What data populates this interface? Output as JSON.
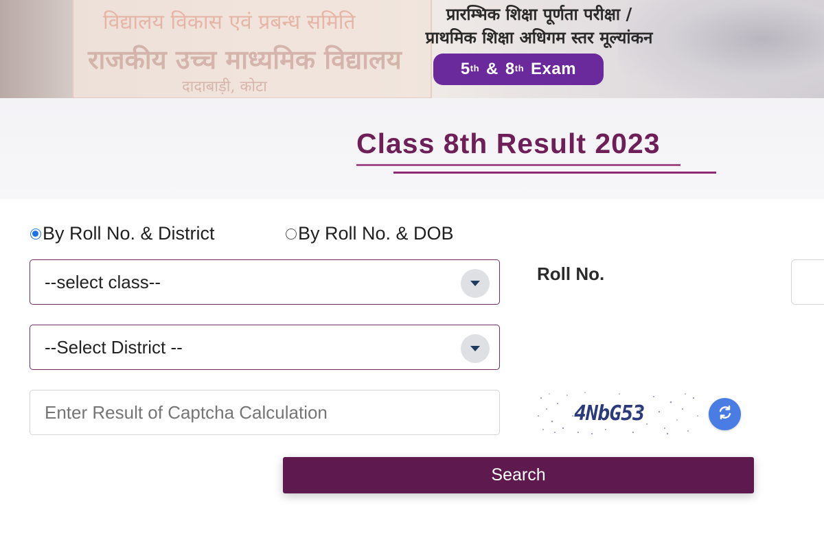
{
  "banner": {
    "background_text_line1": "विद्यालय विकास एवं प्रबन्ध समिति",
    "background_text_line2": "राजकीय उच्च माध्यमिक विद्यालय",
    "background_text_line3": "दादाबाड़ी, कोटा",
    "title_line1": "प्रारम्भिक शिक्षा पूर्णता परीक्षा /",
    "title_line2": "प्राथमिक शिक्षा अधिगम स्तर मूल्यांकन",
    "exam_badge": {
      "num1": "5",
      "sup1": "th",
      "amp": "&",
      "num2": "8",
      "sup2": "th",
      "word": "Exam",
      "color": "#6b2a9c"
    }
  },
  "page": {
    "title": "Class 8th Result 2023",
    "title_color": "#6e1f58"
  },
  "form": {
    "search_mode": {
      "options": [
        {
          "label": "By Roll No. & District",
          "checked": true
        },
        {
          "label": "By Roll No. & DOB",
          "checked": false
        }
      ]
    },
    "class_select": {
      "selected": "--select class--"
    },
    "district_select": {
      "selected": "--Select District --"
    },
    "roll_no": {
      "label": "Roll No.",
      "value": ""
    },
    "captcha": {
      "input_placeholder": "Enter Result of Captcha Calculation",
      "input_value": "",
      "image_text": "4NbG53"
    },
    "search_button": {
      "label": "Search",
      "color": "#5e1a4f"
    }
  },
  "icons": {
    "select_dropdown": "chevron-down-icon",
    "captcha_refresh": "refresh-icon"
  },
  "colors": {
    "accent_blue": "#1a73e8",
    "refresh_button": "#4a7de3",
    "select_border": "#6d2b5f"
  }
}
